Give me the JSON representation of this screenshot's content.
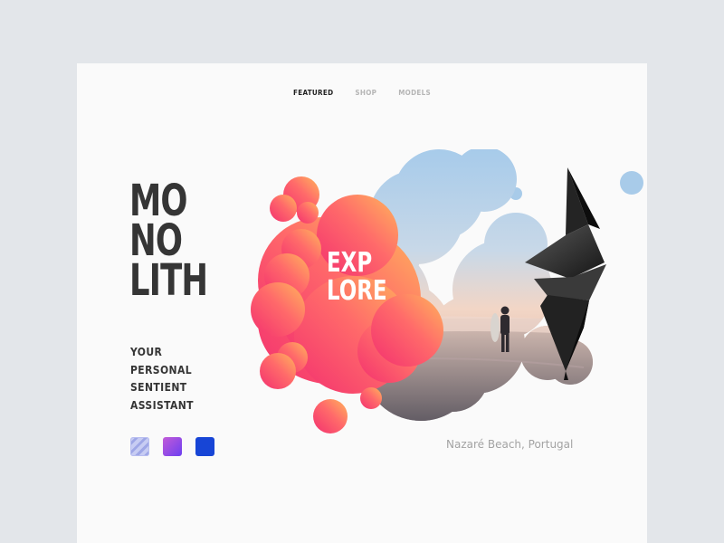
{
  "nav": {
    "items": [
      {
        "label": "FEATURED",
        "active": true
      },
      {
        "label": "SHOP",
        "active": false
      },
      {
        "label": "MODELS",
        "active": false
      }
    ]
  },
  "hero": {
    "title_lines": [
      "MO",
      "NO",
      "LITH"
    ],
    "subtitle_lines": [
      "YOUR",
      "PERSONAL",
      "SENTIENT",
      "ASSISTANT"
    ],
    "explore_lines": [
      "EXP",
      "LORE"
    ],
    "caption": "Nazaré Beach, Portugal"
  },
  "swatches": [
    {
      "name": "periwinkle-pattern",
      "color": "#aab1ee"
    },
    {
      "name": "purple-gradient",
      "color": "#9a4ee4"
    },
    {
      "name": "blue",
      "color": "#1745d6"
    }
  ],
  "colors": {
    "background": "#e3e6ea",
    "card": "#fafafa",
    "title": "#353535",
    "blob_pink": "#f4416f",
    "blob_orange": "#ffb35a",
    "sky_blue": "#a9cbe8"
  }
}
